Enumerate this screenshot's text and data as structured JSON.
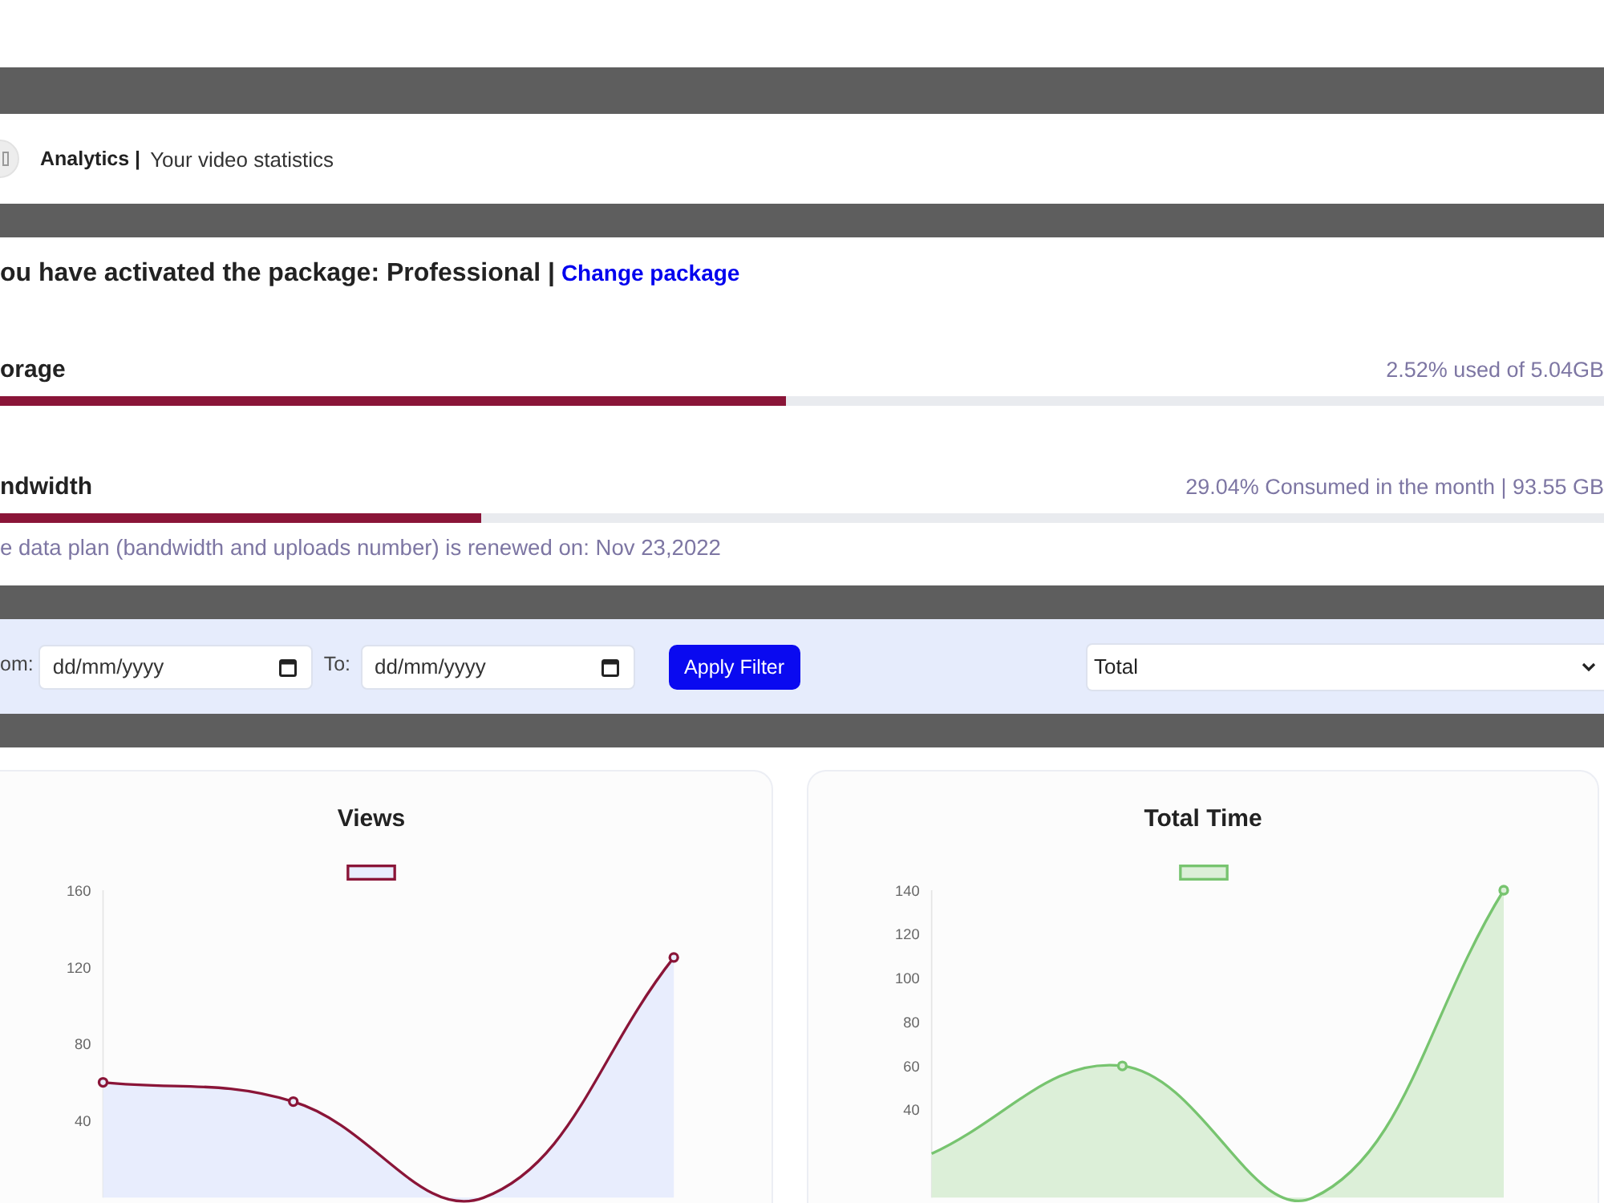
{
  "header": {
    "title": "Analytics |",
    "subtitle": "Your video statistics"
  },
  "package": {
    "status": "ou have activated the package: Professional |",
    "link": "Change package"
  },
  "usage": [
    {
      "label": "orage",
      "reading": "2.52% used of 5.04GB",
      "level": 0.49
    },
    {
      "label": "ndwidth",
      "reading": "29.04% Consumed in the month | 93.55 GB",
      "level": 0.3
    }
  ],
  "renewal_note": "e data plan (bandwidth and uploads number) is renewed on: Nov 23,2022",
  "filter": {
    "from_label": "om:",
    "from": {
      "placeholder": "dd/mm/yyyy"
    },
    "to_label": "To:",
    "to": {
      "placeholder": "dd/mm/yyyy"
    },
    "button": "Apply Filter",
    "period": "Total"
  },
  "charts": [
    {
      "color": "#e8edfd",
      "chart_data": {
        "type": "area",
        "title": "Views",
        "categories": [
          null,
          null,
          null,
          null
        ],
        "series": [
          {
            "color": "#8a1538",
            "values": [
              60,
              50,
              0,
              125
            ]
          }
        ],
        "ylim": [
          0,
          160
        ],
        "yticks": [
          40,
          80,
          120,
          160
        ]
      }
    },
    {
      "color": "#dcefd8",
      "chart_data": {
        "type": "area",
        "title": "Total Time",
        "categories": [
          null,
          null,
          null,
          null
        ],
        "series": [
          {
            "color": "#77c46f",
            "values": [
              20,
              60,
              0,
              140
            ]
          }
        ],
        "ylim": [
          0,
          140
        ],
        "yticks": [
          40,
          60,
          80,
          100,
          120,
          140
        ]
      }
    }
  ]
}
